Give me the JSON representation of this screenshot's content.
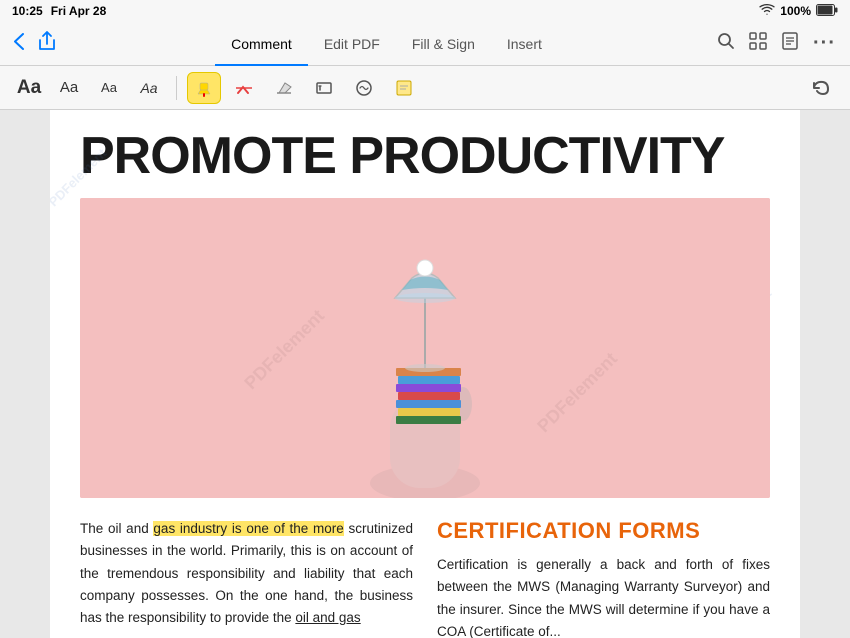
{
  "statusBar": {
    "time": "10:25",
    "date": "Fri Apr 28",
    "wifi": "WiFi",
    "battery": "100%",
    "batteryFull": true
  },
  "navBar": {
    "backIcon": "chevron-left",
    "shareIcon": "share",
    "tabs": [
      {
        "label": "Comment",
        "active": true
      },
      {
        "label": "Edit PDF",
        "active": false
      },
      {
        "label": "Fill & Sign",
        "active": false
      },
      {
        "label": "Insert",
        "active": false
      }
    ],
    "dotsLabel": "...",
    "searchIcon": "search",
    "gridIcon": "grid",
    "readerIcon": "reader",
    "moreIcon": "more"
  },
  "toolbar": {
    "fontButtons": [
      {
        "label": "Aa",
        "size": "large",
        "id": "aa-large"
      },
      {
        "label": "Aa",
        "size": "medium",
        "id": "aa-medium"
      },
      {
        "label": "Aa",
        "size": "small",
        "id": "aa-small"
      },
      {
        "label": "Aa",
        "size": "italic",
        "id": "aa-italic"
      }
    ],
    "highlighterIcon": "highlighter-yellow",
    "strikeIcon": "strikethrough",
    "eraserIcon": "eraser",
    "textboxIcon": "textbox",
    "signatureIcon": "signature",
    "stickyIcon": "sticky-note",
    "undoIcon": "undo"
  },
  "page": {
    "title": "PROMOTE PRODUCTIVITY",
    "watermarks": [
      "PDFelement",
      "PDFelement",
      "PDFelement"
    ],
    "imageAlt": "Hand holding stack of books with cocktail glass",
    "leftColumn": {
      "text1": "The oil and",
      "text2": "gas industry is one of the more",
      "text3": " scrutinized businesses in the world. Primarily, this is on account of the tremendous responsibility and liability that each company possesses. On the one hand, the business has the responsibility to provide the ",
      "text4": "oil and gas",
      "highlightedPhrase": "gas industry is one of the more"
    },
    "rightColumn": {
      "heading": "CERTIFICATION FORMS",
      "body": "Certification is generally a back and forth of fixes between the MWS (Managing Warranty Surveyor) and the insurer. Since the MWS will determine if you have a COA (Certificate of..."
    }
  }
}
